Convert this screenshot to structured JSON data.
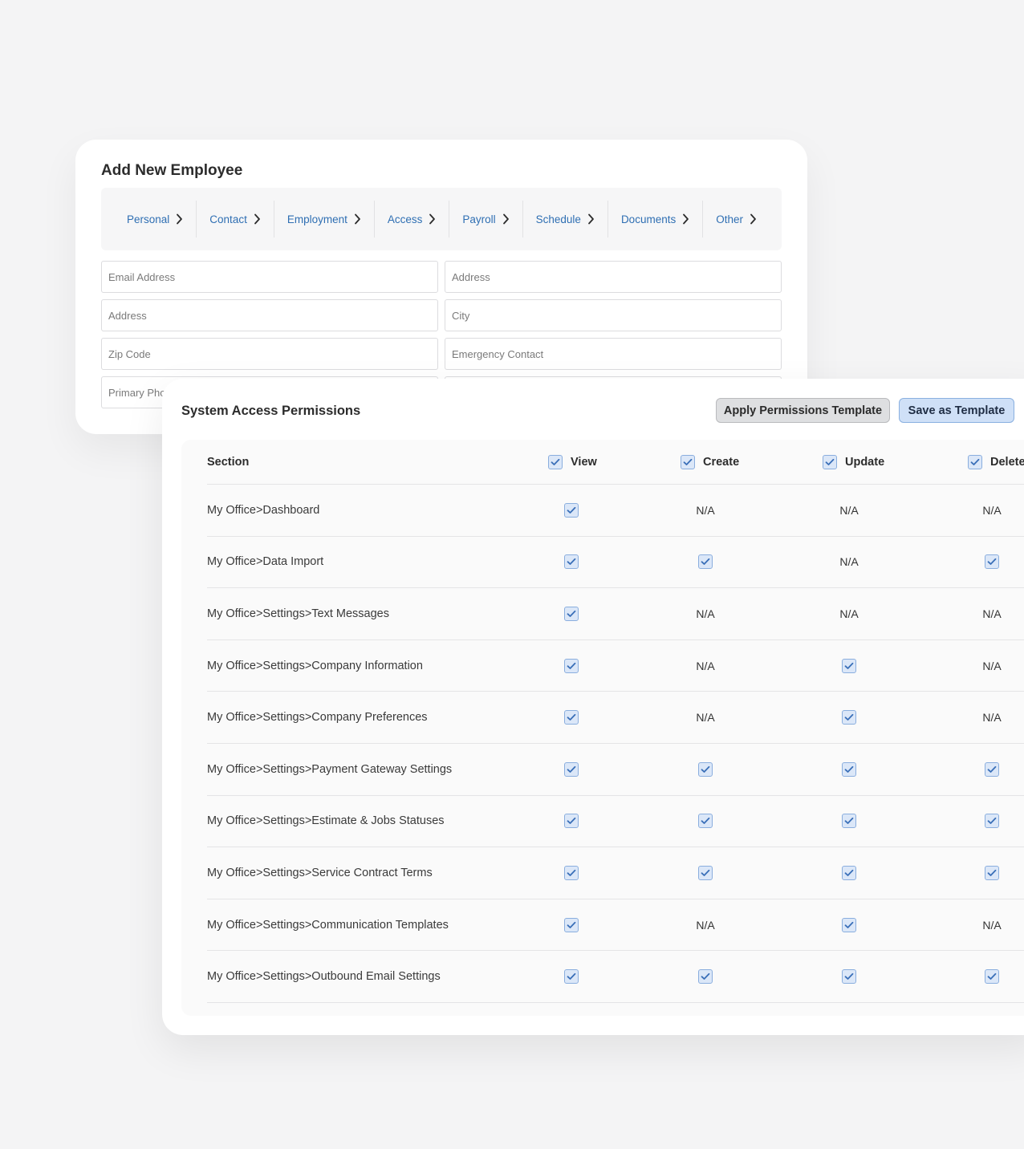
{
  "employee_form": {
    "title": "Add New Employee",
    "steps": [
      {
        "label": "Personal"
      },
      {
        "label": "Contact"
      },
      {
        "label": "Employment"
      },
      {
        "label": "Access"
      },
      {
        "label": "Payroll"
      },
      {
        "label": "Schedule"
      },
      {
        "label": "Documents"
      },
      {
        "label": "Other"
      }
    ],
    "fields": {
      "email": {
        "placeholder": "Email Address"
      },
      "address_right": {
        "placeholder": "Address"
      },
      "address_left": {
        "placeholder": "Address"
      },
      "city": {
        "placeholder": "City"
      },
      "zip": {
        "placeholder": "Zip Code"
      },
      "emergency": {
        "placeholder": "Emergency Contact"
      },
      "primary_phone": {
        "placeholder": "Primary Phone"
      }
    }
  },
  "permissions": {
    "title": "System Access Permissions",
    "apply_label": "Apply Permissions Template",
    "save_label": "Save as Template",
    "columns": {
      "section": "Section",
      "view": "View",
      "create": "Create",
      "update": "Update",
      "delete": "Delete"
    },
    "na_text": "N/A",
    "rows": [
      {
        "section": "My Office>Dashboard",
        "view": "checked",
        "create": "N/A",
        "update": "N/A",
        "delete": "N/A"
      },
      {
        "section": "My Office>Data Import",
        "view": "checked",
        "create": "checked",
        "update": "N/A",
        "delete": "checked"
      },
      {
        "section": "My Office>Settings>Text Messages",
        "view": "checked",
        "create": "N/A",
        "update": "N/A",
        "delete": "N/A"
      },
      {
        "section": "My Office>Settings>Company Information",
        "view": "checked",
        "create": "N/A",
        "update": "checked",
        "delete": "N/A"
      },
      {
        "section": "My Office>Settings>Company Preferences",
        "view": "checked",
        "create": "N/A",
        "update": "checked",
        "delete": "N/A"
      },
      {
        "section": "My Office>Settings>Payment Gateway Settings",
        "view": "checked",
        "create": "checked",
        "update": "checked",
        "delete": "checked"
      },
      {
        "section": "My Office>Settings>Estimate & Jobs Statuses",
        "view": "checked",
        "create": "checked",
        "update": "checked",
        "delete": "checked"
      },
      {
        "section": "My Office>Settings>Service Contract Terms",
        "view": "checked",
        "create": "checked",
        "update": "checked",
        "delete": "checked"
      },
      {
        "section": "My Office>Settings>Communication Templates",
        "view": "checked",
        "create": "N/A",
        "update": "checked",
        "delete": "N/A"
      },
      {
        "section": "My Office>Settings>Outbound Email Settings",
        "view": "checked",
        "create": "checked",
        "update": "checked",
        "delete": "checked"
      }
    ]
  },
  "colors": {
    "accent": "#2f6fb3",
    "checkbox_fill": "#dbe7f8",
    "checkbox_border": "#8aaede"
  }
}
